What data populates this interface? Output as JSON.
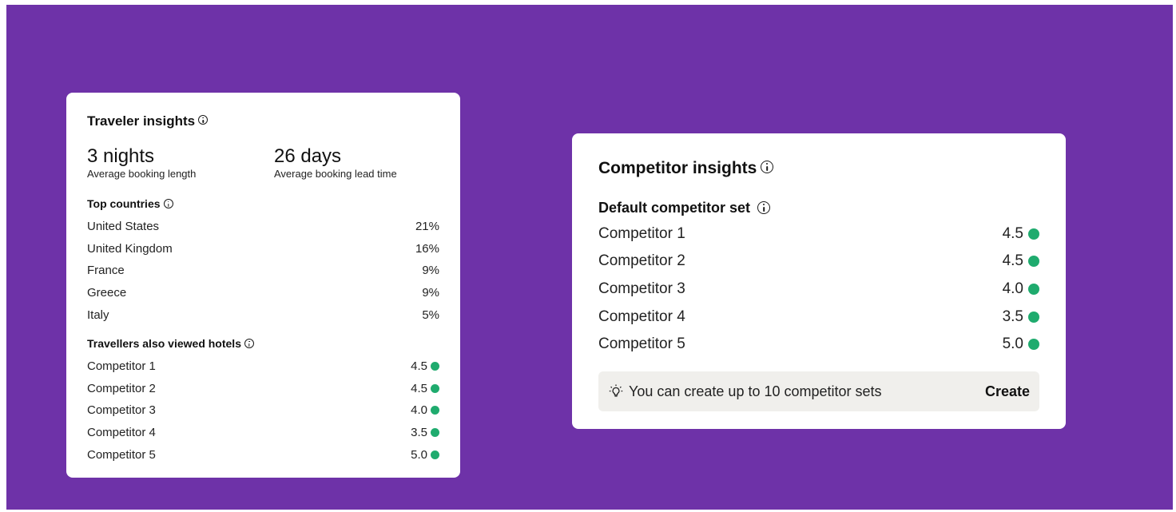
{
  "traveler": {
    "title": "Traveler insights",
    "stats": [
      {
        "value": "3 nights",
        "label": "Average booking length"
      },
      {
        "value": "26 days",
        "label": "Average booking lead time"
      }
    ],
    "countries_title": "Top countries",
    "countries": [
      {
        "name": "United States",
        "pct": "21%"
      },
      {
        "name": "United Kingdom",
        "pct": "16%"
      },
      {
        "name": "France",
        "pct": "9%"
      },
      {
        "name": "Greece",
        "pct": "9%"
      },
      {
        "name": "Italy",
        "pct": "5%"
      }
    ],
    "hotels_title": "Travellers also viewed hotels",
    "hotels": [
      {
        "name": "Competitor 1",
        "score": "4.5"
      },
      {
        "name": "Competitor 2",
        "score": "4.5"
      },
      {
        "name": "Competitor 3",
        "score": "4.0"
      },
      {
        "name": "Competitor 4",
        "score": "3.5"
      },
      {
        "name": "Competitor 5",
        "score": "5.0"
      }
    ]
  },
  "competitor": {
    "title": "Competitor insights",
    "set_title": "Default competitor set",
    "items": [
      {
        "name": "Competitor 1",
        "score": "4.5"
      },
      {
        "name": "Competitor 2",
        "score": "4.5"
      },
      {
        "name": "Competitor 3",
        "score": "4.0"
      },
      {
        "name": "Competitor 4",
        "score": "3.5"
      },
      {
        "name": "Competitor 5",
        "score": "5.0"
      }
    ],
    "banner": {
      "icon": "lightbulb-icon",
      "message": "You can create up to 10 competitor sets",
      "action": "Create"
    }
  },
  "colors": {
    "background": "#6e32a8",
    "card": "#ffffff",
    "score_dot": "#1fab6e",
    "banner": "#f0efec"
  }
}
